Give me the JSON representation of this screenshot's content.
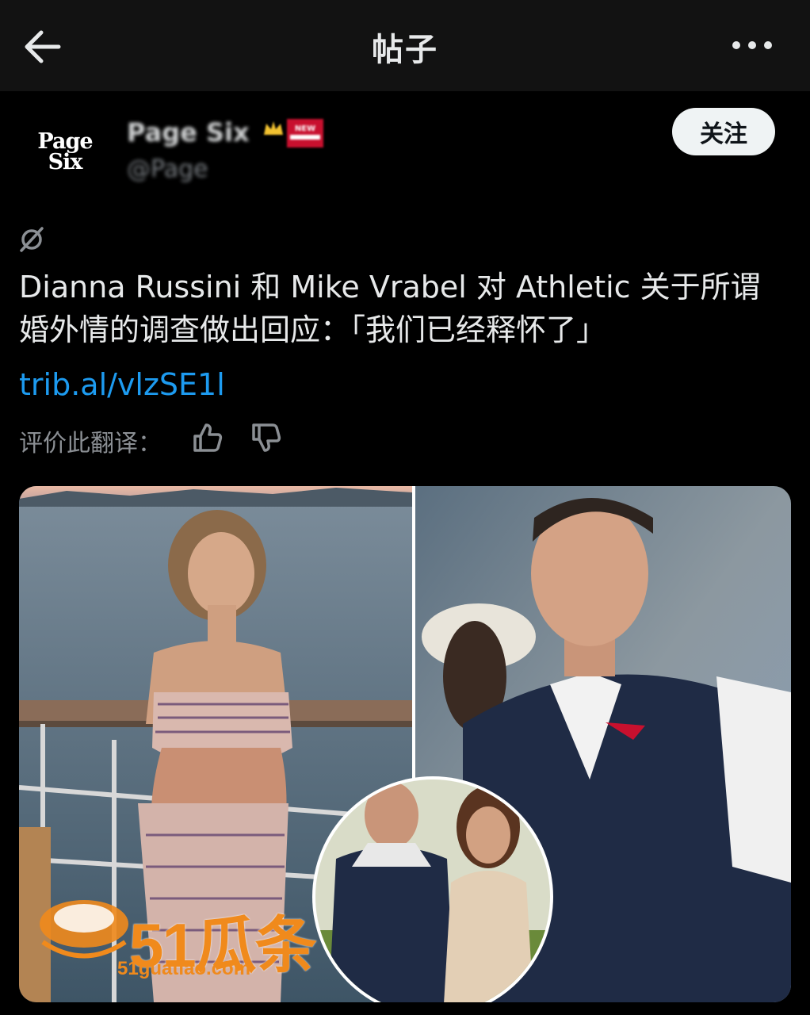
{
  "topbar": {
    "title": "帖子"
  },
  "account": {
    "avatar_text_line1": "Page",
    "avatar_text_line2": "Six",
    "name": "Page Six",
    "handle": "@Page",
    "badge": "NEW"
  },
  "follow_button": {
    "label": "关注"
  },
  "post": {
    "text": "Dianna Russini 和 Mike Vrabel 对 Athletic 关于所谓婚外情的调查做出回应：「我们已经释怀了」",
    "link": "trib.al/vlzSE1l"
  },
  "translation_feedback": {
    "label": "评价此翻译："
  },
  "media": {
    "watermark": "51瓜条",
    "watermark_url": "51guatiao.com"
  },
  "colors": {
    "background": "#000000",
    "topbar": "#121212",
    "link": "#1d9bf0",
    "watermark": "#f08a1c"
  }
}
